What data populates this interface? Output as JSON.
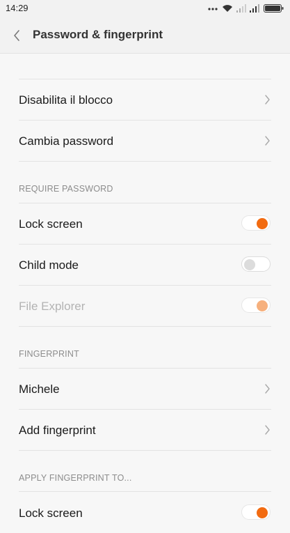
{
  "status_bar": {
    "time": "14:29",
    "icons": [
      "more-dots-icon",
      "wifi-icon",
      "signal-weak-icon",
      "signal-icon",
      "battery-icon"
    ]
  },
  "header": {
    "back_icon": "chevron-left-icon",
    "title": "Password & fingerprint"
  },
  "top_items": [
    {
      "label": "Disabilita il blocco",
      "icon": "chevron-right-icon"
    },
    {
      "label": "Cambia password",
      "icon": "chevron-right-icon"
    }
  ],
  "require_password": {
    "header": "REQUIRE PASSWORD",
    "items": [
      {
        "label": "Lock screen",
        "toggle": "on"
      },
      {
        "label": "Child mode",
        "toggle": "off"
      },
      {
        "label": "File Explorer",
        "toggle": "on",
        "disabled": true
      }
    ]
  },
  "fingerprint": {
    "header": "FINGERPRINT",
    "items": [
      {
        "label": "Michele",
        "icon": "chevron-right-icon"
      },
      {
        "label": "Add fingerprint",
        "icon": "chevron-right-icon"
      }
    ]
  },
  "apply_fingerprint": {
    "header": "APPLY FINGERPRINT TO...",
    "items": [
      {
        "label": "Lock screen",
        "toggle": "on"
      }
    ]
  },
  "colors": {
    "accent": "#f26b11",
    "accent_disabled": "#f6b07d",
    "background": "#f7f7f7"
  }
}
